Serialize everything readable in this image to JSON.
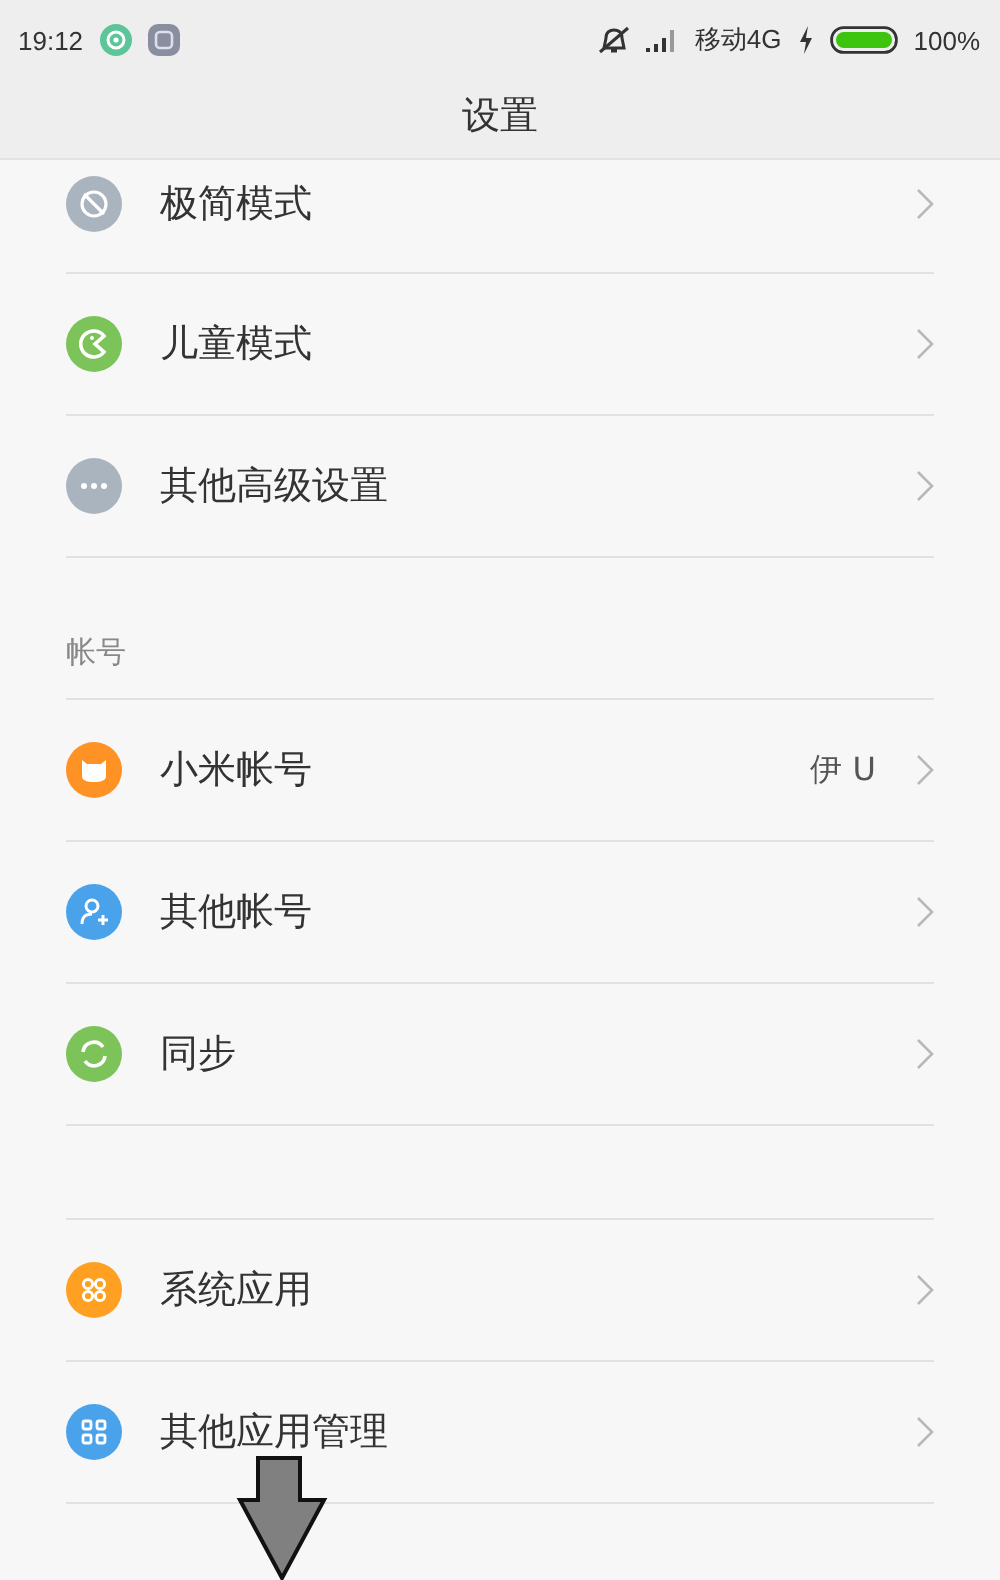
{
  "status_bar": {
    "time": "19:12",
    "carrier": "移动4G",
    "battery": "100%"
  },
  "header": {
    "title": "设置"
  },
  "sections": [
    {
      "rows": [
        {
          "label": "极简模式",
          "kind": "minimal",
          "color": "#aab4bf"
        },
        {
          "label": "儿童模式",
          "kind": "kid",
          "color": "#7cc35a"
        },
        {
          "label": "其他高级设置",
          "kind": "more",
          "color": "#aab4bf"
        }
      ]
    },
    {
      "title": "帐号",
      "rows": [
        {
          "label": "小米帐号",
          "kind": "mi",
          "color": "#ff9224",
          "value": "伊 U"
        },
        {
          "label": "其他帐号",
          "kind": "person",
          "color": "#4aa3ea"
        },
        {
          "label": "同步",
          "kind": "sync",
          "color": "#7cc35a"
        }
      ]
    },
    {
      "rows": [
        {
          "label": "系统应用",
          "kind": "apps",
          "color": "#ffa023"
        },
        {
          "label": "其他应用管理",
          "kind": "grid",
          "color": "#4aa3ea"
        }
      ]
    }
  ]
}
